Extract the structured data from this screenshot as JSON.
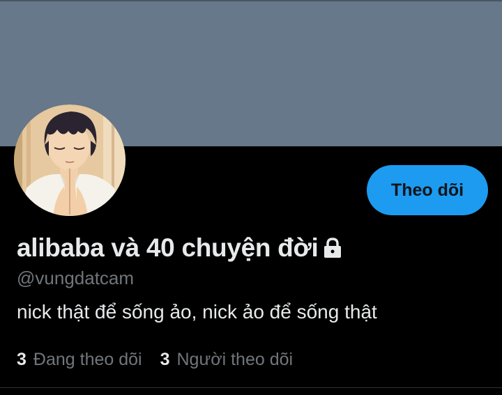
{
  "profile": {
    "display_name": "alibaba và 40 chuyện đời",
    "handle": "@vungdatcam",
    "bio": "nick thật để sống ảo, nick ảo để sống thật",
    "follow_label": "Theo dõi",
    "locked_icon": "lock-icon",
    "stats": {
      "following_count": "3",
      "following_label": "Đang theo dõi",
      "followers_count": "3",
      "followers_label": "Người theo dõi"
    }
  },
  "colors": {
    "banner": "#66788a",
    "background": "#000000",
    "accent": "#1d9bf0",
    "primary_text": "#e7e9ea",
    "secondary_text": "#71767b"
  }
}
